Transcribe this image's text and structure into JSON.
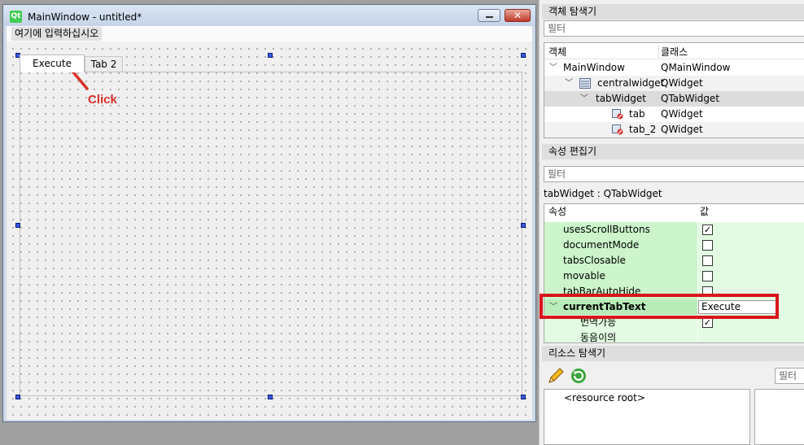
{
  "form_window": {
    "title": "MainWindow - untitled*",
    "logo_text": "Qt",
    "close_label": "✕",
    "menu_placeholder": "여기에 입력하십시오",
    "tabs": [
      {
        "label": "Execute",
        "selected": true
      },
      {
        "label": "Tab 2",
        "selected": false
      }
    ]
  },
  "annotation": {
    "text": "Click",
    "color": "#d9312b"
  },
  "object_inspector": {
    "title": "객체 탐색기",
    "filter_placeholder": "필터",
    "columns": [
      "객체",
      "클래스"
    ],
    "rows": [
      {
        "name": "MainWindow",
        "class": "QMainWindow"
      },
      {
        "name": "centralwidget",
        "class": "QWidget"
      },
      {
        "name": "tabWidget",
        "class": "QTabWidget",
        "selected": true
      },
      {
        "name": "tab",
        "class": "QWidget"
      },
      {
        "name": "tab_2",
        "class": "QWidget"
      }
    ]
  },
  "property_editor": {
    "title": "속성 편집기",
    "filter_placeholder": "필터",
    "context": "tabWidget : QTabWidget",
    "columns": [
      "속성",
      "값"
    ],
    "rows": [
      {
        "name": "usesScrollButtons",
        "checked": true
      },
      {
        "name": "documentMode",
        "checked": false
      },
      {
        "name": "tabsClosable",
        "checked": false
      },
      {
        "name": "movable",
        "checked": false
      },
      {
        "name": "tabBarAutoHide",
        "checked": false
      },
      {
        "name": "currentTabText",
        "value": "Execute",
        "expanded": true
      },
      {
        "name": "번역가능",
        "checked": true
      },
      {
        "name": "동음이의",
        "value": ""
      }
    ],
    "highlight_color": "#d8161b"
  },
  "resource_browser": {
    "title": "리소스 탐색기",
    "filter_placeholder": "필터",
    "root_label": "<resource root>",
    "icons": [
      "pencil-icon",
      "reload-icon"
    ]
  },
  "colors": {
    "property_row_green": "#ccf5cc",
    "property_row_green_alt": "#e2fbe2",
    "selection_gray": "#dcdcdc"
  }
}
